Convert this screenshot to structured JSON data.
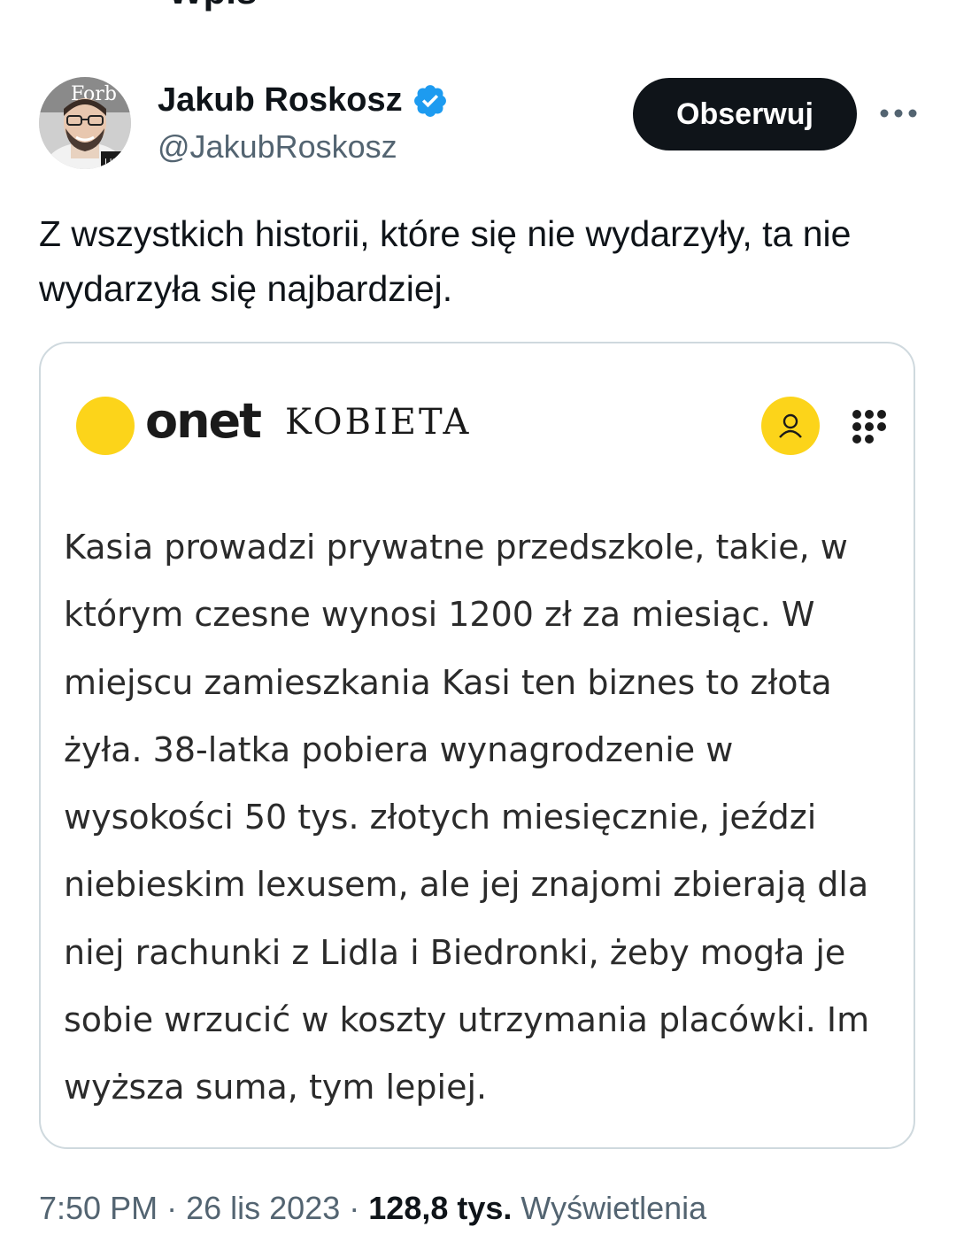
{
  "header": {
    "back_icon": "arrow-left-icon",
    "title": "Wpis"
  },
  "author": {
    "display_name": "Jakub Roskosz",
    "handle": "@JakubRoskosz",
    "verified_icon": "verified-badge-icon",
    "verified_color": "#1d9bf0",
    "avatar_icon": "profile-photo"
  },
  "actions": {
    "follow_label": "Obserwuj",
    "more_icon": "more-horizontal-icon"
  },
  "tweet": {
    "text": "Z wszystkich historii, które się nie wydarzyły, ta nie wydarzyła się najbardziej."
  },
  "media": {
    "brand": "onet",
    "section": "KOBIETA",
    "brand_color": "#fcd41a",
    "user_icon": "user-icon",
    "menu_icon": "grid-menu-icon",
    "article_text": "Kasia prowadzi prywatne przedszkole, takie, w którym czesne wynosi 1200 zł za miesiąc. W miejscu zamieszkania Kasi ten biznes to złota żyła. 38-latka pobiera wynagrodzenie w wysokości 50 tys. złotych miesięcznie, jeździ niebieskim lexusem, ale jej znajomi zbierają dla niej rachunki z Lidla i Biedronki, żeby mogła je sobie wrzucić w koszty utrzymania placówki. Im wyższa suma, tym lepiej."
  },
  "meta": {
    "time": "7:50 PM",
    "separator": "·",
    "date": "26 lis 2023",
    "views_count": "128,8 tys.",
    "views_label": "Wyświetlenia"
  }
}
